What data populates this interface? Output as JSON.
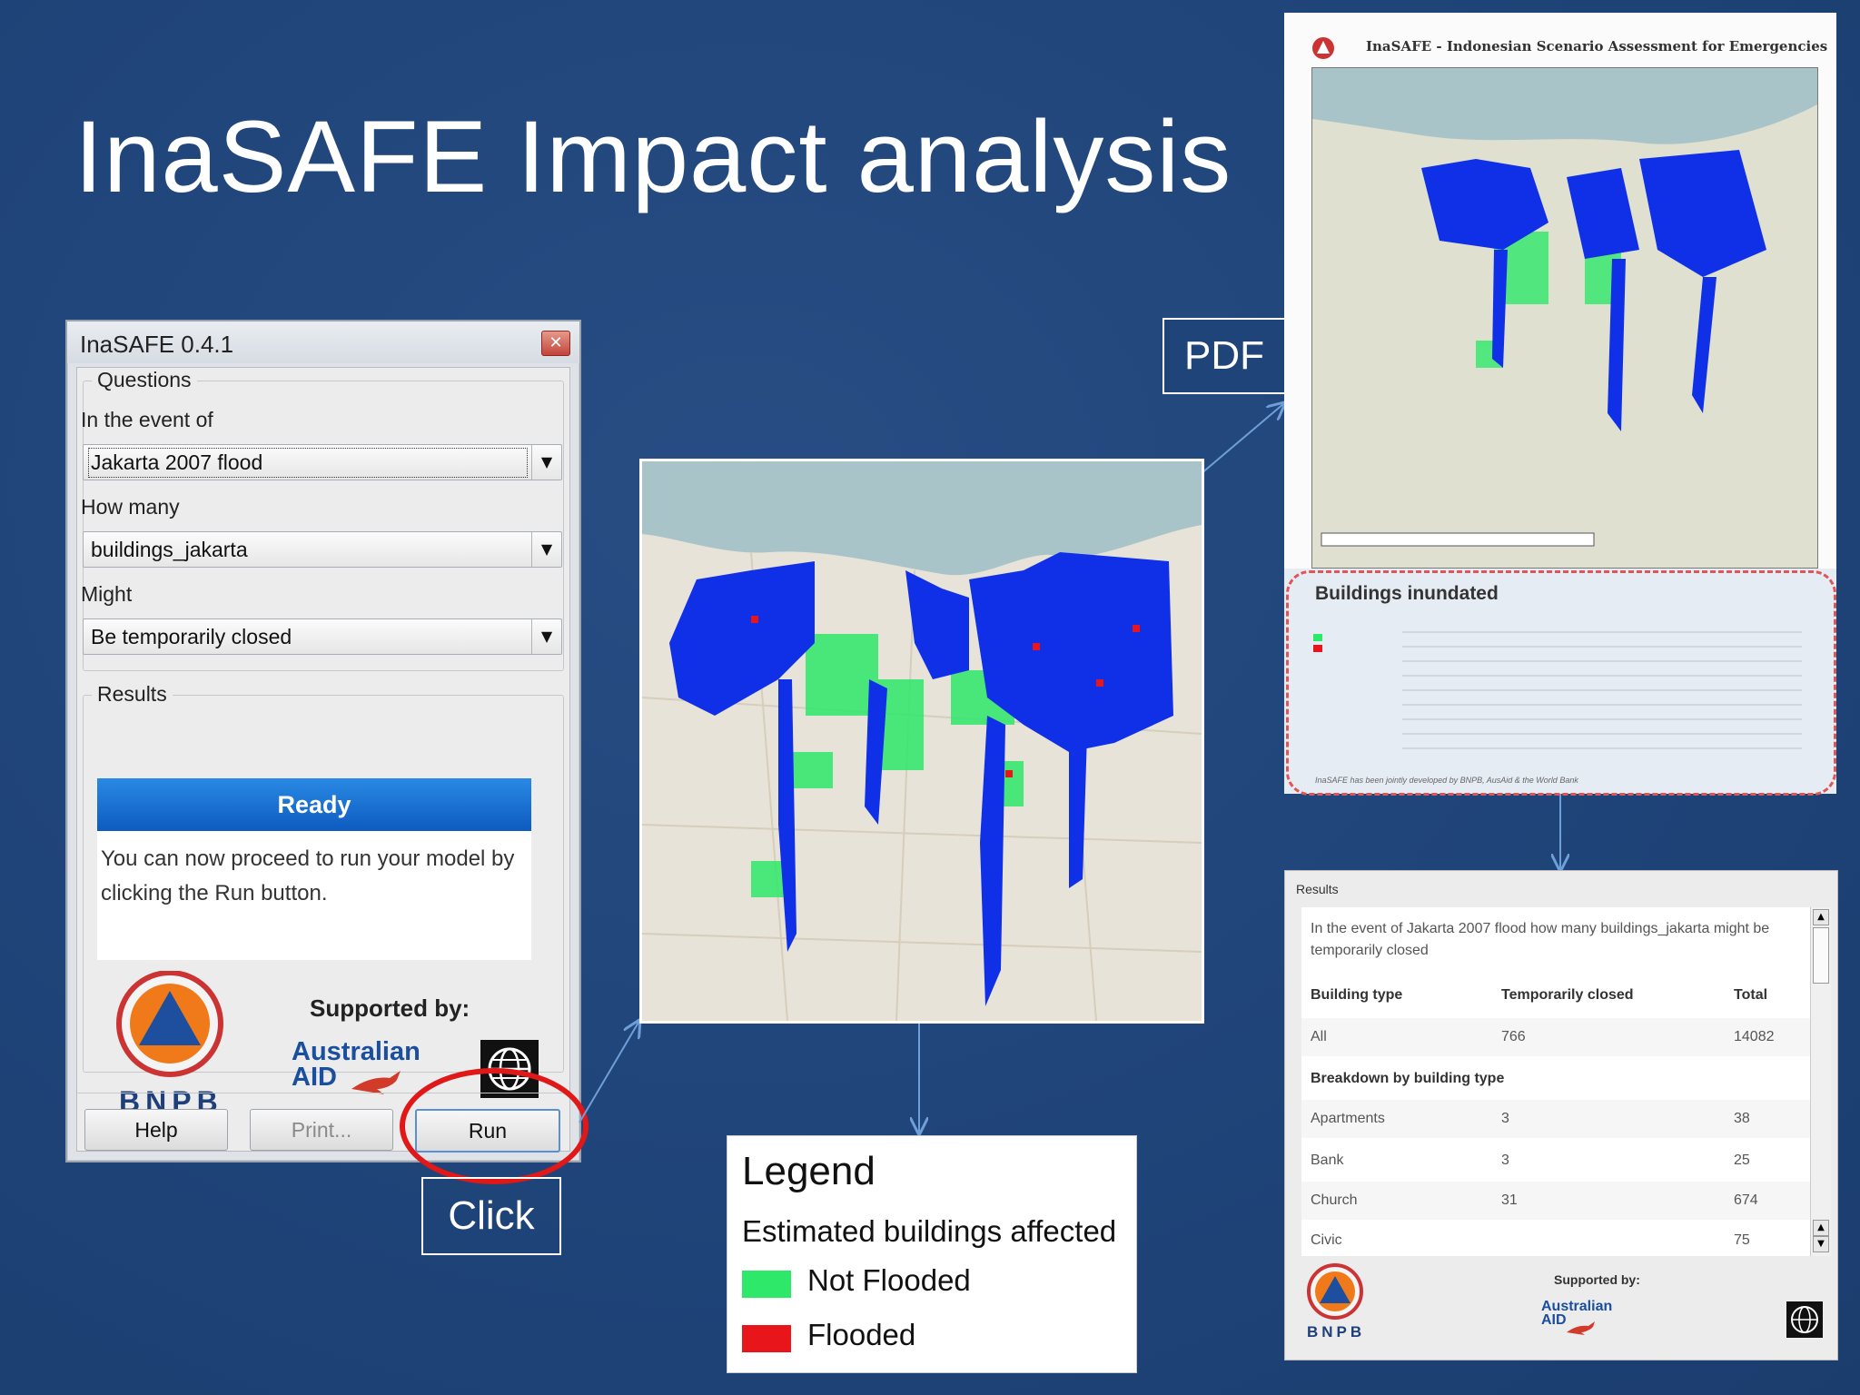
{
  "slide": {
    "title": "InaSAFE Impact analysis",
    "callouts": {
      "pdf": "PDF",
      "click": "Click"
    }
  },
  "dialog": {
    "title": "InaSAFE 0.4.1",
    "questions": {
      "group_label": "Questions",
      "event_label": "In the event of",
      "event_value": "Jakarta 2007 flood",
      "how_many_label": "How many",
      "how_many_value": "buildings_jakarta",
      "might_label": "Might",
      "might_value": "Be temporarily closed"
    },
    "results": {
      "group_label": "Results",
      "status": "Ready",
      "message": "You can now proceed to run your model by clicking the Run button."
    },
    "support": {
      "label": "Supported by:",
      "bnpb": "BNPB",
      "ausaid_line1": "Australian",
      "ausaid_line2": "AID"
    },
    "buttons": {
      "help": "Help",
      "print": "Print...",
      "run": "Run"
    }
  },
  "legend": {
    "title": "Legend",
    "subtitle": "Estimated buildings affected",
    "items": [
      {
        "label": "Not Flooded",
        "color": "#2ee86a"
      },
      {
        "label": "Flooded",
        "color": "#e8161b"
      }
    ]
  },
  "pdf_report": {
    "header": "InaSAFE - Indonesian Scenario Assessment for Emergencies",
    "section_title": "Buildings inundated",
    "footer_note": "InaSAFE has been jointly developed by BNPB, AusAid & the World Bank"
  },
  "results_table": {
    "label": "Results",
    "intro": "In the event of Jakarta 2007 flood how many buildings_jakarta might be temporarily closed",
    "columns": [
      "Building type",
      "Temporarily closed",
      "Total"
    ],
    "total_row": [
      "All",
      "766",
      "14082"
    ],
    "breakdown_label": "Breakdown by building type",
    "rows": [
      [
        "Apartments",
        "3",
        "38"
      ],
      [
        "Bank",
        "3",
        "25"
      ],
      [
        "Church",
        "31",
        "674"
      ],
      [
        "Civic",
        "",
        "75"
      ]
    ],
    "support_label": "Supported by:",
    "bnpb": "BNPB",
    "ausaid_line1": "Australian",
    "ausaid_line2": "AID"
  },
  "colors": {
    "slide_background": "#1f4479",
    "flood_blue": "#1030e8",
    "not_flooded_green": "#2ee86a",
    "flooded_red": "#e8161b",
    "ready_blue": "#1a6fd6",
    "highlight_ring": "#e01818"
  }
}
